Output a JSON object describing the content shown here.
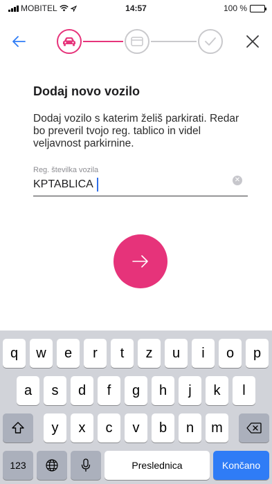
{
  "status_bar": {
    "carrier": "MOBITEL",
    "time": "14:57",
    "battery": "100 %"
  },
  "colors": {
    "accent": "#e6337a",
    "inactive": "#c9c9cc",
    "back_arrow": "#2f7cf6",
    "keyboard_bg": "#d1d3d9",
    "done_key": "#2f7cf6"
  },
  "stepper": {
    "steps": [
      {
        "icon": "car-icon",
        "state": "active"
      },
      {
        "icon": "card-icon",
        "state": "inactive"
      },
      {
        "icon": "checkmark-icon",
        "state": "inactive"
      }
    ]
  },
  "main": {
    "title": "Dodaj novo vozilo",
    "description": "Dodaj vozilo s katerim želiš parkirati. Redar bo preveril tvojo reg. tablico in videl veljavnost parkirnine.",
    "field_label": "Reg. številka vozila",
    "field_value": "KPTABLICA"
  },
  "keyboard": {
    "row1": [
      "q",
      "w",
      "e",
      "r",
      "t",
      "z",
      "u",
      "i",
      "o",
      "p"
    ],
    "row2": [
      "a",
      "s",
      "d",
      "f",
      "g",
      "h",
      "j",
      "k",
      "l"
    ],
    "row3": [
      "y",
      "x",
      "c",
      "v",
      "b",
      "n",
      "m"
    ],
    "numbers_label": "123",
    "space_label": "Preslednica",
    "done_label": "Končano"
  }
}
